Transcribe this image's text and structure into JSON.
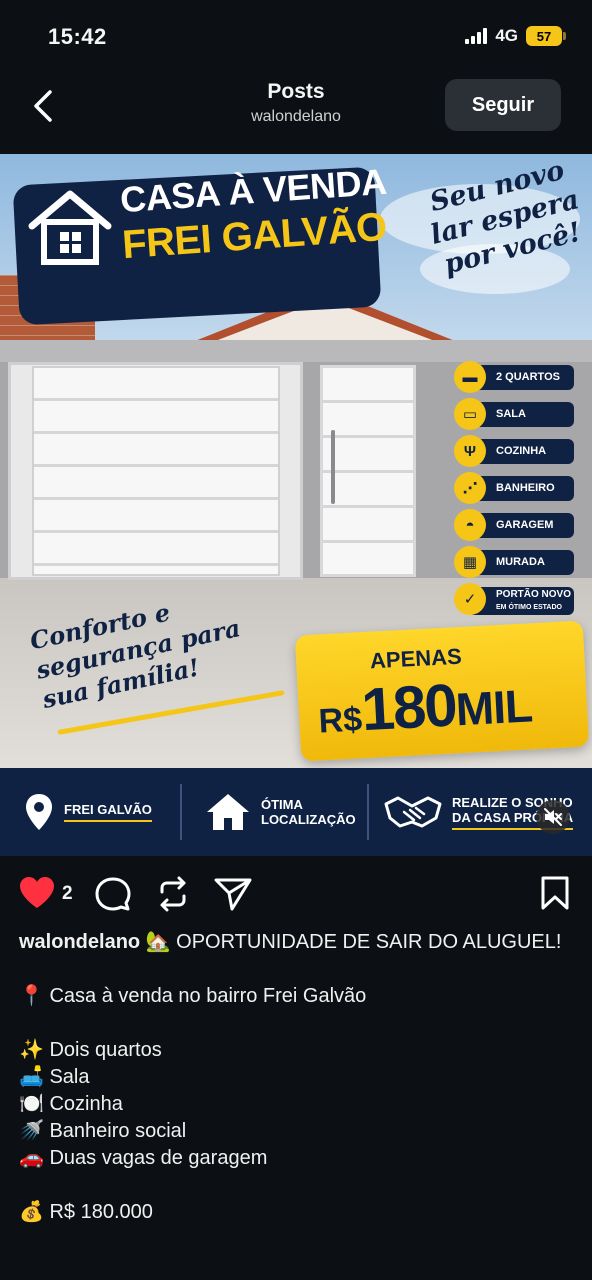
{
  "status_bar": {
    "time": "15:42",
    "network": "4G",
    "battery": "57"
  },
  "header": {
    "title": "Posts",
    "username": "walondelano",
    "follow_label": "Seguir"
  },
  "post_image": {
    "banner_line1": "CASA À VENDA",
    "banner_line2": "FREI GALVÃO",
    "tagline": "Seu novo lar espera por você!",
    "features": [
      {
        "icon": "bed-icon",
        "label": "2 QUARTOS"
      },
      {
        "icon": "sofa-icon",
        "label": "SALA"
      },
      {
        "icon": "fork-knife-icon",
        "label": "COZINHA"
      },
      {
        "icon": "shower-icon",
        "label": "BANHEIRO"
      },
      {
        "icon": "car-icon",
        "label": "GARAGEM"
      },
      {
        "icon": "brick-wall-icon",
        "label": "MURADA"
      },
      {
        "icon": "check-icon",
        "label": "PORTÃO NOVO",
        "sub": "EM ÓTIMO ESTADO"
      }
    ],
    "comfort_text": "Conforto e segurança para sua família!",
    "price_prefix": "APENAS",
    "price_currency": "R$",
    "price_value": "180",
    "price_unit": "MIL",
    "footer": {
      "location": "FREI GALVÃO",
      "localizacao_1": "ÓTIMA",
      "localizacao_2": "LOCALIZAÇÃO",
      "dream_1": "REALIZE O SONHO",
      "dream_2": "DA CASA PRÓPRIA"
    }
  },
  "actions": {
    "like_count": "2"
  },
  "caption": {
    "username": "walondelano",
    "headline": "🏡 OPORTUNIDADE DE SAIR DO ALUGUEL!",
    "line_location": "📍 Casa à venda no bairro Frei Galvão",
    "items": [
      "✨ Dois quartos",
      "🛋️ Sala",
      "🍽️ Cozinha",
      "🚿 Banheiro social",
      "🚗 Duas vagas de garagem"
    ],
    "price_line": "💰 R$ 180.000"
  },
  "colors": {
    "navy": "#0f2244",
    "yellow": "#f5c518",
    "like_red": "#ff3040",
    "background": "#0c1014"
  }
}
